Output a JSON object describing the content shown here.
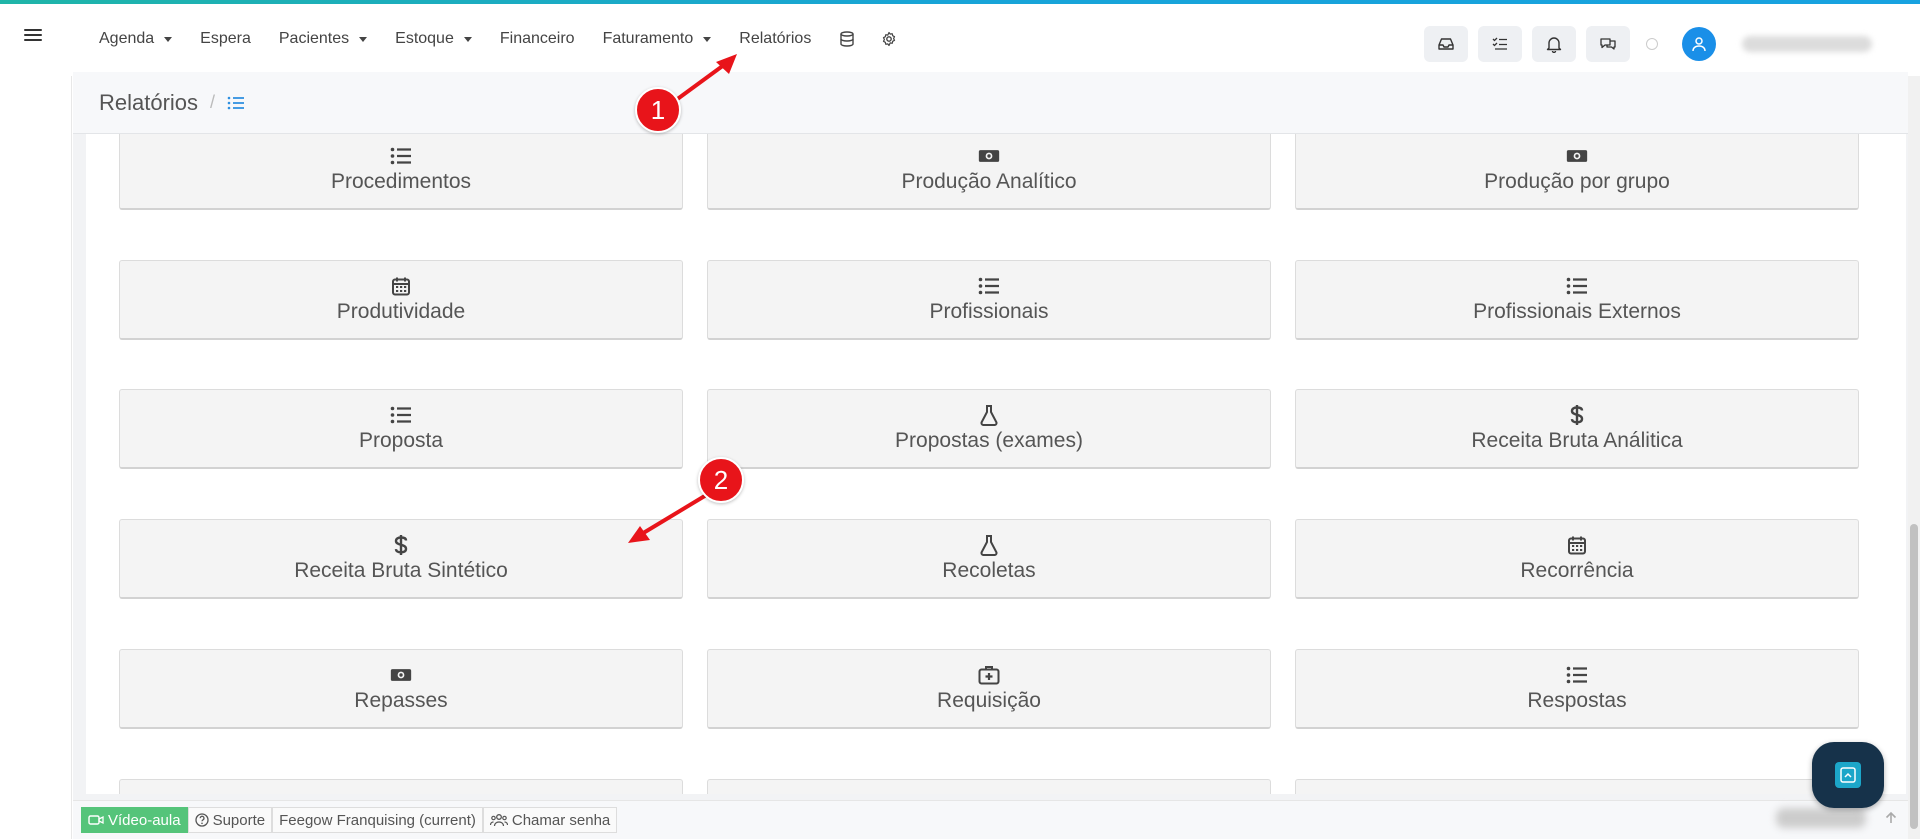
{
  "nav": {
    "items": [
      {
        "label": "Agenda",
        "caret": true
      },
      {
        "label": "Espera",
        "caret": false
      },
      {
        "label": "Pacientes",
        "caret": true
      },
      {
        "label": "Estoque",
        "caret": true
      },
      {
        "label": "Financeiro",
        "caret": false
      },
      {
        "label": "Faturamento",
        "caret": true
      },
      {
        "label": "Relatórios",
        "caret": false
      }
    ],
    "icons": [
      "database-icon",
      "gear-icon"
    ],
    "tools": [
      "inbox-icon",
      "task-list-icon",
      "bell-icon",
      "chat-icon"
    ]
  },
  "page": {
    "title": "Relatórios",
    "crumb_icon": "list-icon"
  },
  "reports": [
    {
      "label": "Procedimentos",
      "icon": "list-icon"
    },
    {
      "label": "Produção Analítico",
      "icon": "money-icon"
    },
    {
      "label": "Produção por grupo",
      "icon": "money-icon"
    },
    {
      "label": "Produtividade",
      "icon": "calendar-icon"
    },
    {
      "label": "Profissionais",
      "icon": "list-icon"
    },
    {
      "label": "Profissionais Externos",
      "icon": "list-icon"
    },
    {
      "label": "Proposta",
      "icon": "list-icon"
    },
    {
      "label": "Propostas (exames)",
      "icon": "flask-icon"
    },
    {
      "label": "Receita Bruta Análitica",
      "icon": "dollar-icon"
    },
    {
      "label": "Receita Bruta Sintético",
      "icon": "dollar-icon"
    },
    {
      "label": "Recoletas",
      "icon": "flask-icon"
    },
    {
      "label": "Recorrência",
      "icon": "calendar-icon"
    },
    {
      "label": "Repasses",
      "icon": "money-icon"
    },
    {
      "label": "Requisição",
      "icon": "medical-kit-icon"
    },
    {
      "label": "Respostas",
      "icon": "list-icon"
    }
  ],
  "footer": {
    "video_label": "Vídeo-aula",
    "support_label": "Suporte",
    "franchise_label": "Feegow Franquising (current)",
    "call_label": "Chamar senha"
  },
  "annotations": {
    "badge1": "1",
    "badge2": "2",
    "color": "#e8141a"
  },
  "colors": {
    "accent": "#17a2e0",
    "avatar": "#1a8fe8",
    "video_green": "#55c47a",
    "fab": "#16324a"
  }
}
